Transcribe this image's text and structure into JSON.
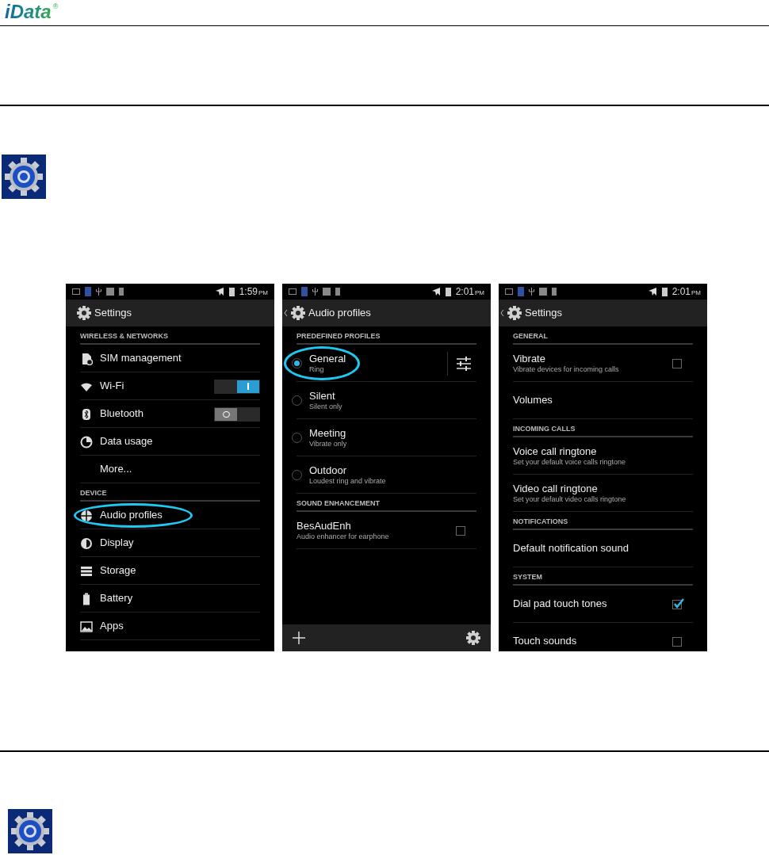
{
  "logo": {
    "text": "iData",
    "mark": "®"
  },
  "screens": [
    {
      "time": "1:59",
      "meridiem": "PM",
      "title": "Settings",
      "back": false,
      "footer": false,
      "rows": [
        {
          "kind": "header",
          "label": "WIRELESS & NETWORKS"
        },
        {
          "kind": "link",
          "label": "SIM management",
          "highlighted": false
        },
        {
          "kind": "toggle",
          "label": "Wi-Fi",
          "on": true
        },
        {
          "kind": "toggle",
          "label": "Bluetooth",
          "on": false
        },
        {
          "kind": "link",
          "label": "Data usage",
          "highlighted": false
        },
        {
          "kind": "link",
          "label": "More...",
          "highlighted": false
        },
        {
          "kind": "header",
          "label": "DEVICE"
        },
        {
          "kind": "link",
          "label": "Audio profiles",
          "highlighted": true
        },
        {
          "kind": "link",
          "label": "Display",
          "highlighted": false
        },
        {
          "kind": "link",
          "label": "Storage",
          "highlighted": false
        },
        {
          "kind": "link",
          "label": "Battery",
          "highlighted": false
        },
        {
          "kind": "link",
          "label": "Apps",
          "highlighted": false
        }
      ]
    },
    {
      "time": "2:01",
      "meridiem": "PM",
      "title": "Audio profiles",
      "back": true,
      "footer": true,
      "rows": [
        {
          "kind": "header",
          "label": "PREDEFINED PROFILES"
        },
        {
          "kind": "radio",
          "label": "General",
          "sub": "Ring",
          "selected": true,
          "highlighted": true,
          "tune": true
        },
        {
          "kind": "radio",
          "label": "Silent",
          "sub": "Silent only",
          "selected": false,
          "highlighted": false,
          "tune": false
        },
        {
          "kind": "radio",
          "label": "Meeting",
          "sub": "Vibrate only",
          "selected": false,
          "highlighted": false,
          "tune": false
        },
        {
          "kind": "radio",
          "label": "Outdoor",
          "sub": "Loudest ring and vibrate",
          "selected": false,
          "highlighted": false,
          "tune": false
        },
        {
          "kind": "header",
          "label": "SOUND ENHANCEMENT"
        },
        {
          "kind": "checkbox",
          "label": "BesAudEnh",
          "sub": "Audio enhancer for earphone",
          "checked": false
        }
      ]
    },
    {
      "time": "2:01",
      "meridiem": "PM",
      "title": "Settings",
      "back": true,
      "footer": false,
      "rows": [
        {
          "kind": "header",
          "label": "GENERAL"
        },
        {
          "kind": "checkbox",
          "label": "Vibrate",
          "sub": "Vibrate devices for incoming calls",
          "checked": false
        },
        {
          "kind": "link",
          "label": "Volumes",
          "highlighted": false
        },
        {
          "kind": "header",
          "label": "INCOMING CALLS"
        },
        {
          "kind": "link",
          "label": "Voice call ringtone",
          "sub": "Set your default voice calls ringtone",
          "highlighted": false
        },
        {
          "kind": "link",
          "label": "Video call ringtone",
          "sub": "Set your default video calls ringtone",
          "highlighted": false
        },
        {
          "kind": "header",
          "label": "NOTIFICATIONS"
        },
        {
          "kind": "link",
          "label": "Default notification sound",
          "highlighted": false
        },
        {
          "kind": "header",
          "label": "SYSTEM"
        },
        {
          "kind": "checkbox",
          "label": "Dial pad touch tones",
          "checked": true
        },
        {
          "kind": "checkbox",
          "label": "Touch sounds",
          "checked": false
        }
      ]
    }
  ]
}
